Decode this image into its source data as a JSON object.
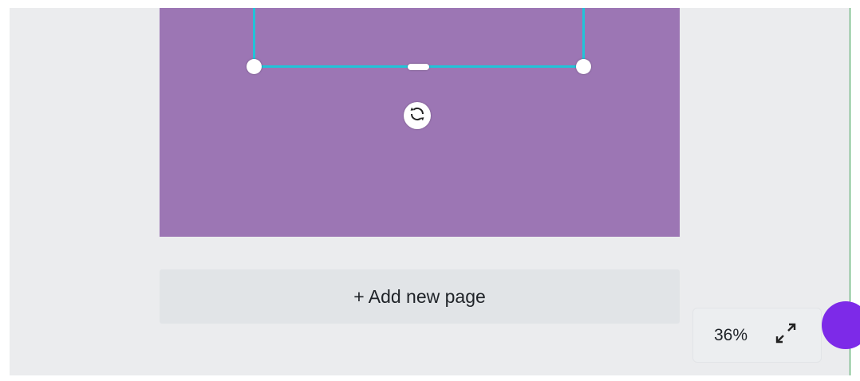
{
  "canvas": {
    "page_color": "#9c76b4",
    "selection_color": "#20c4d8",
    "rotate_icon": "rotate-icon"
  },
  "add_page": {
    "label": "+ Add new page"
  },
  "zoom": {
    "value": "36%",
    "expand_icon": "expand-icon"
  },
  "help": {
    "color": "#7d2ae8"
  }
}
